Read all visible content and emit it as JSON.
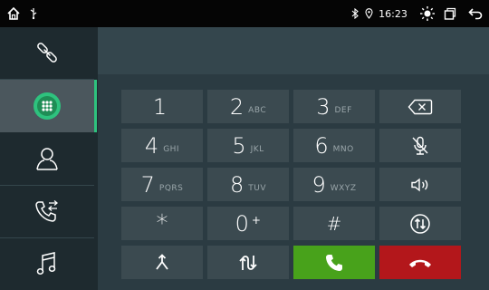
{
  "status_bar": {
    "time": "16:23",
    "icons": [
      "home-icon",
      "usb-icon",
      "bluetooth-icon",
      "location-icon",
      "brightness-icon",
      "recent-apps-icon",
      "back-icon"
    ]
  },
  "sidebar": {
    "items": [
      {
        "icon": "bluetooth-link-icon",
        "active": false
      },
      {
        "icon": "dialpad-icon",
        "active": true
      },
      {
        "icon": "contacts-icon",
        "active": false
      },
      {
        "icon": "call-log-icon",
        "active": false
      },
      {
        "icon": "music-icon",
        "active": false
      }
    ]
  },
  "display": {
    "number": ""
  },
  "keypad": {
    "k1": {
      "digit": "1",
      "letters": ""
    },
    "k2": {
      "digit": "2",
      "letters": "ABC"
    },
    "k3": {
      "digit": "3",
      "letters": "DEF"
    },
    "k4": {
      "digit": "4",
      "letters": "GHI"
    },
    "k5": {
      "digit": "5",
      "letters": "JKL"
    },
    "k6": {
      "digit": "6",
      "letters": "MNO"
    },
    "k7": {
      "digit": "7",
      "letters": "PQRS"
    },
    "k8": {
      "digit": "8",
      "letters": "TUV"
    },
    "k9": {
      "digit": "9",
      "letters": "WXYZ"
    },
    "star": {
      "digit": "*",
      "letters": ""
    },
    "k0": {
      "digit": "0",
      "letters": "+"
    },
    "hash": {
      "digit": "#",
      "letters": ""
    }
  },
  "function_keys": [
    "backspace-icon",
    "mute-mic-icon",
    "speaker-icon",
    "switch-audio-icon",
    "merge-call-icon",
    "swap-call-icon",
    "call-icon",
    "hangup-icon"
  ],
  "colors": {
    "accent": "#2ec27e",
    "call": "#48a21b",
    "hangup": "#b3171b",
    "key": "#3b4a50",
    "background": "#2b3b42"
  }
}
